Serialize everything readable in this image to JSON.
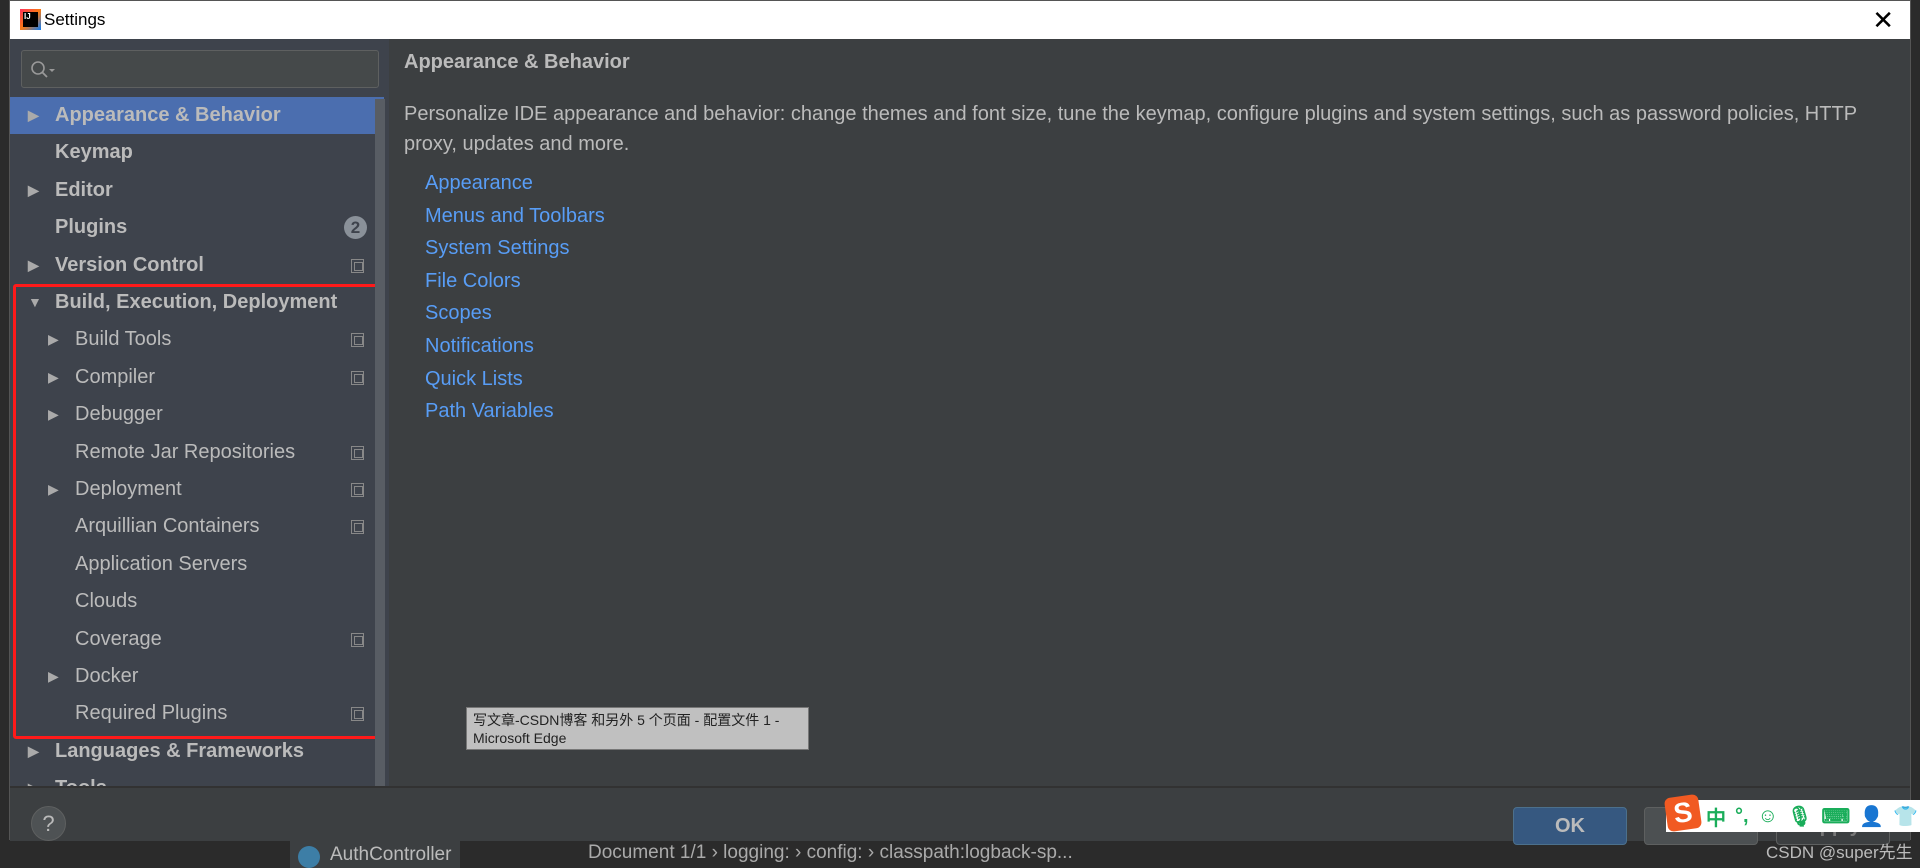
{
  "window": {
    "title": "Settings",
    "icon": "intellij-logo-icon",
    "logo_text": "IJ"
  },
  "background": {
    "tab": "AuthController",
    "breadcrumb": "Document 1/1  ›  logging:  ›  config:  ›  classpath:logback-sp..."
  },
  "search": {
    "placeholder": ""
  },
  "sidebar": {
    "items": [
      {
        "label": "Appearance & Behavior",
        "level": 0,
        "expandable": true,
        "expanded": false,
        "selected": true
      },
      {
        "label": "Keymap",
        "level": 0,
        "expandable": false
      },
      {
        "label": "Editor",
        "level": 0,
        "expandable": true,
        "expanded": false
      },
      {
        "label": "Plugins",
        "level": 0,
        "expandable": false,
        "badge": "2"
      },
      {
        "label": "Version Control",
        "level": 0,
        "expandable": true,
        "expanded": false,
        "project_icon": true
      },
      {
        "label": "Build, Execution, Deployment",
        "level": 0,
        "expandable": true,
        "expanded": true
      },
      {
        "label": "Build Tools",
        "level": 1,
        "expandable": true,
        "project_icon": true
      },
      {
        "label": "Compiler",
        "level": 1,
        "expandable": true,
        "project_icon": true
      },
      {
        "label": "Debugger",
        "level": 1,
        "expandable": true
      },
      {
        "label": "Remote Jar Repositories",
        "level": 1,
        "expandable": false,
        "project_icon": true
      },
      {
        "label": "Deployment",
        "level": 1,
        "expandable": true,
        "project_icon": true
      },
      {
        "label": "Arquillian Containers",
        "level": 1,
        "expandable": false,
        "project_icon": true
      },
      {
        "label": "Application Servers",
        "level": 1,
        "expandable": false
      },
      {
        "label": "Clouds",
        "level": 1,
        "expandable": false
      },
      {
        "label": "Coverage",
        "level": 1,
        "expandable": false,
        "project_icon": true
      },
      {
        "label": "Docker",
        "level": 1,
        "expandable": true
      },
      {
        "label": "Required Plugins",
        "level": 1,
        "expandable": false,
        "project_icon": true
      },
      {
        "label": "Languages & Frameworks",
        "level": 0,
        "expandable": true,
        "expanded": false
      },
      {
        "label": "Tools",
        "level": 0,
        "expandable": true,
        "expanded": false
      }
    ]
  },
  "content": {
    "title": "Appearance & Behavior",
    "description": "Personalize IDE appearance and behavior: change themes and font size, tune the keymap, configure plugins and system settings, such as password policies, HTTP proxy, updates and more.",
    "links": [
      "Appearance",
      "Menus and Toolbars",
      "System Settings",
      "File Colors",
      "Scopes",
      "Notifications",
      "Quick Lists",
      "Path Variables"
    ]
  },
  "footer": {
    "help": "?",
    "ok": "OK",
    "cancel": "Cancel",
    "apply": "Apply"
  },
  "tooltip": {
    "line1": "写文章-CSDN博客 和另外 5 个页面 - 配置文件 1 -",
    "line2": "Microsoft Edge"
  },
  "ime": {
    "logo": "S",
    "mode": "中",
    "punct": "°,"
  },
  "watermark": "CSDN @super先生",
  "colors": {
    "selection": "#4b6eaf",
    "link": "#589df6",
    "highlight_box": "#ff1a1a",
    "ok_button": "#365880"
  }
}
